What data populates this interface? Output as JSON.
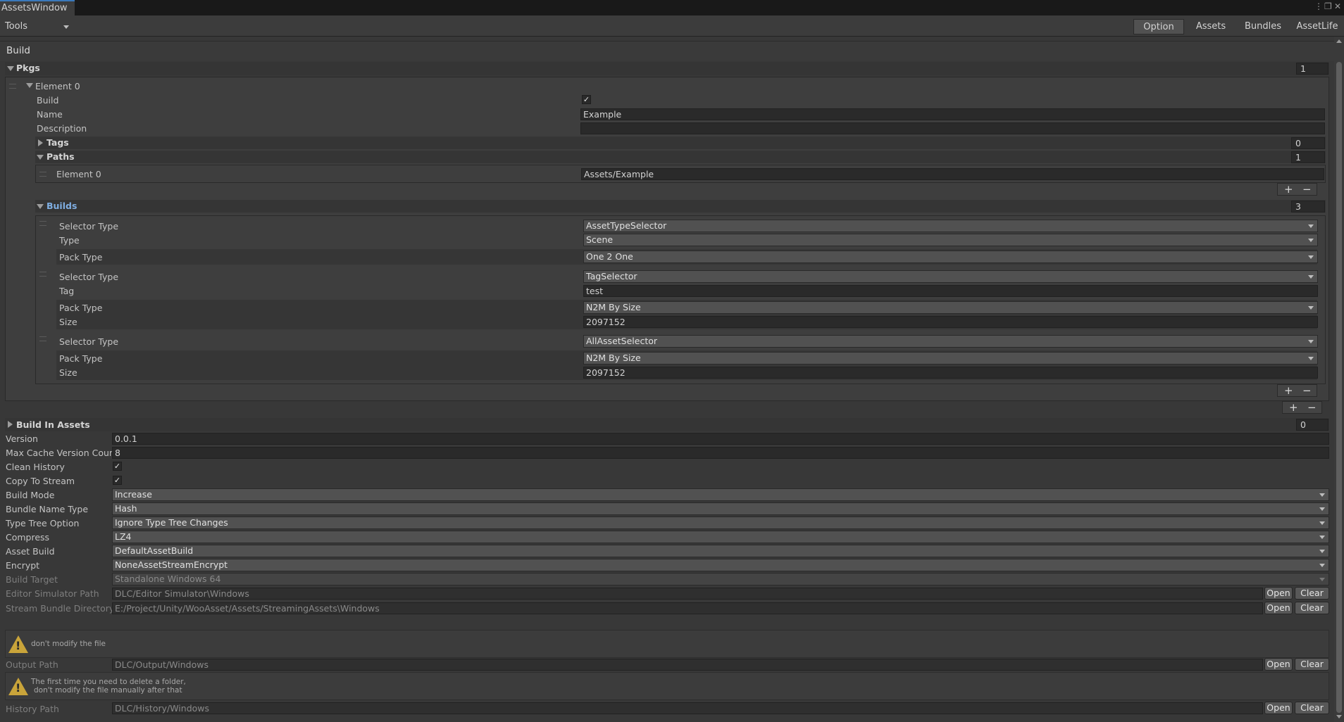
{
  "window": {
    "tab_title": "AssetsWindow",
    "tools_label": "Tools",
    "tabs": [
      "Option",
      "Assets",
      "Bundles",
      "AssetLife"
    ],
    "selected_tab": "Option",
    "header": "Build"
  },
  "pkgs": {
    "label": "Pkgs",
    "count": "1",
    "element_label": "Element 0",
    "build_label": "Build",
    "build_checked": true,
    "name_label": "Name",
    "name_value": "Example",
    "description_label": "Description",
    "description_value": "",
    "tags_label": "Tags",
    "tags_count": "0",
    "paths_label": "Paths",
    "paths_count": "1",
    "path_element_label": "Element 0",
    "path_element_value": "Assets/Example",
    "builds_label": "Builds",
    "builds_count": "3",
    "builds": {
      "b0": {
        "selector_type_label": "Selector Type",
        "selector_type": "AssetTypeSelector",
        "type_label": "Type",
        "type_value": "Scene",
        "pack_type_label": "Pack Type",
        "pack_type": "One 2 One"
      },
      "b1": {
        "selector_type_label": "Selector Type",
        "selector_type": "TagSelector",
        "tag_label": "Tag",
        "tag_value": "test",
        "pack_type_label": "Pack Type",
        "pack_type": "N2M By Size",
        "size_label": "Size",
        "size_value": "2097152"
      },
      "b2": {
        "selector_type_label": "Selector Type",
        "selector_type": "AllAssetSelector",
        "pack_type_label": "Pack Type",
        "pack_type": "N2M By Size",
        "size_label": "Size",
        "size_value": "2097152"
      }
    }
  },
  "settings": {
    "build_in_assets_label": "Build In Assets",
    "build_in_assets_count": "0",
    "version_label": "Version",
    "version_value": "0.0.1",
    "max_cache_label": "Max Cache Version Count",
    "max_cache_value": "8",
    "clean_history_label": "Clean History",
    "clean_history": true,
    "copy_to_stream_label": "Copy To Stream",
    "copy_to_stream": true,
    "build_mode_label": "Build Mode",
    "build_mode": "Increase",
    "bundle_name_type_label": "Bundle Name Type",
    "bundle_name_type": "Hash",
    "type_tree_label": "Type Tree Option",
    "type_tree": "Ignore Type Tree Changes",
    "compress_label": "Compress",
    "compress": "LZ4",
    "asset_build_label": "Asset Build",
    "asset_build": "DefaultAssetBuild",
    "encrypt_label": "Encrypt",
    "encrypt": "NoneAssetStreamEncrypt",
    "build_target_label": "Build Target",
    "build_target": "Standalone Windows 64",
    "editor_sim_label": "Editor Simulator Path",
    "editor_sim_value": "DLC/Editor Simulator\\Windows",
    "stream_dir_label": "Stream Bundle Directory",
    "stream_dir_value": "E:/Project/Unity/WooAsset/Assets/StreamingAssets\\Windows",
    "warn1": "don't modify the file",
    "output_label": "Output Path",
    "output_value": "DLC/Output/Windows",
    "warn2_line1": "The first time you need to delete a folder,",
    "warn2_line2": "don't modify the file manually after that",
    "history_label": "History Path",
    "history_value": "DLC/History/Windows",
    "open_label": "Open",
    "clear_label": "Clear"
  }
}
